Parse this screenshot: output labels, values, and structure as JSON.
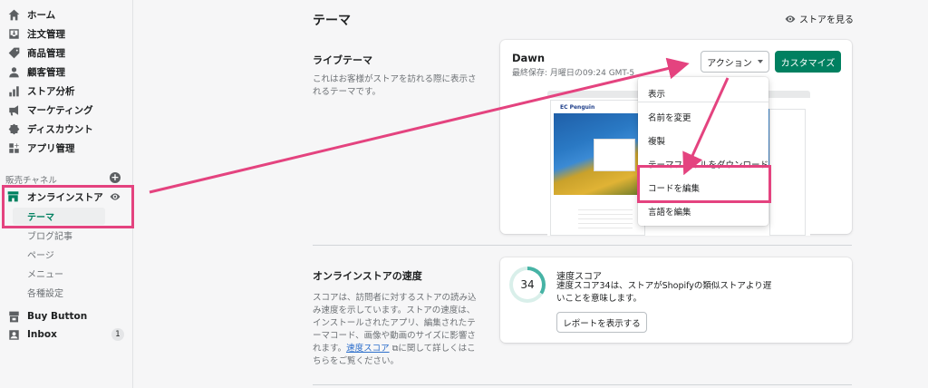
{
  "sidebar": {
    "items": [
      {
        "label": "ホーム",
        "icon": "home-icon"
      },
      {
        "label": "注文管理",
        "icon": "orders-icon"
      },
      {
        "label": "商品管理",
        "icon": "tag-icon"
      },
      {
        "label": "顧客管理",
        "icon": "person-icon"
      },
      {
        "label": "ストア分析",
        "icon": "bar-chart-icon"
      },
      {
        "label": "マーケティング",
        "icon": "megaphone-icon"
      },
      {
        "label": "ディスカウント",
        "icon": "discount-icon"
      },
      {
        "label": "アプリ管理",
        "icon": "apps-icon"
      }
    ],
    "channels_label": "販売チャネル",
    "online_store": "オンラインストア",
    "sub_items": [
      "テーマ",
      "ブログ記事",
      "ページ",
      "メニュー",
      "各種設定"
    ],
    "buy_button": "Buy Button",
    "inbox": "Inbox",
    "inbox_badge": "1"
  },
  "header": {
    "title": "テーマ",
    "view_store": "ストアを見る"
  },
  "live_theme": {
    "title": "ライブテーマ",
    "description": "これはお客様がストアを訪れる際に表示されるテーマです。",
    "theme_name": "Dawn",
    "last_saved": "最終保存: 月曜日の09:24 GMT-5",
    "action_button": "アクション",
    "customize_button": "カスタマイズ",
    "preview_logo": "EC Penguin"
  },
  "dropdown": {
    "items": [
      "表示",
      "名前を変更",
      "複製",
      "テーマファイルをダウンロード",
      "コードを編集",
      "言語を編集"
    ]
  },
  "speed": {
    "title": "オンラインストアの速度",
    "description_pre": "スコアは、訪問者に対するストアの読み込み速度を示しています。ストアの速度は、インストールされたアプリ、編集されたテーマコード、画像や動画のサイズに影響されます。",
    "link": "速度スコア",
    "description_post": "に関して詳しくはこちらをご覧ください。",
    "score": "34",
    "score_title": "速度スコア",
    "score_desc": "速度スコア34は、ストアがShopifyの類似ストアより遅いことを意味します。",
    "report_button": "レポートを表示する"
  },
  "colors": {
    "accent": "#008060",
    "highlight": "#e4437f",
    "link": "#2c6ecb"
  }
}
